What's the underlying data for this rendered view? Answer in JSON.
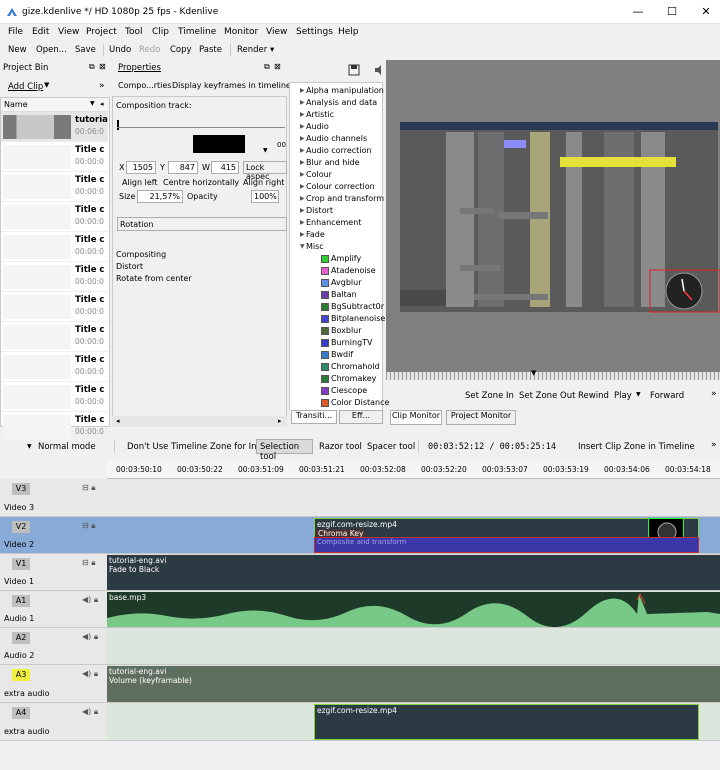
{
  "window": {
    "title": "gize.kdenlive */ HD 1080p 25 fps - Kdenlive",
    "minimize": "—",
    "maximize": "☐",
    "close": "✕"
  },
  "menu": [
    "File",
    "Edit",
    "View",
    "Project",
    "Tool",
    "Clip",
    "Timeline",
    "Monitor",
    "View",
    "Settings",
    "Help"
  ],
  "toolbar": [
    "New",
    "Open...",
    "Save",
    "Undo",
    "Redo",
    "Copy",
    "Paste",
    "Render ▾"
  ],
  "project_bin": {
    "title": "Project Bin",
    "add_clip": "Add Clip",
    "name_header": "Name",
    "clips": [
      {
        "name": "tutoria",
        "dur": "00:06:0"
      },
      {
        "name": "Title c",
        "dur": "00:00:0"
      },
      {
        "name": "Title c",
        "dur": "00:00:0"
      },
      {
        "name": "Title c",
        "dur": "00:00:0"
      },
      {
        "name": "Title c",
        "dur": "00:00:0"
      },
      {
        "name": "Title c",
        "dur": "00:00:0"
      },
      {
        "name": "Title c",
        "dur": "00:00:0"
      },
      {
        "name": "Title c",
        "dur": "00:00:0"
      },
      {
        "name": "Title c",
        "dur": "00:00:0"
      },
      {
        "name": "Title c",
        "dur": "00:00:0"
      },
      {
        "name": "Title c",
        "dur": "00:00:0"
      }
    ]
  },
  "properties": {
    "title": "Properties",
    "tab_compo": "Compo...rties",
    "tab_keyframes": "Display keyframes in timeline",
    "comp_track": "Composition track:",
    "x_label": "X",
    "x": "1505",
    "y_label": "Y",
    "y": "847",
    "w_label": "W",
    "w": "415",
    "lock": "Lock aspec",
    "align_left": "Align left",
    "centre_h": "Centre horizontally",
    "align_right": "Align right",
    "size_label": "Size",
    "size": "21,57%",
    "opacity_label": "Opacity",
    "opacity": "100%",
    "rotation": "Rotation",
    "list": [
      "Compositing",
      "Distort",
      "Rotate from center"
    ]
  },
  "effects": {
    "categories": [
      "Alpha manipulation",
      "Analysis and data",
      "Artistic",
      "Audio",
      "Audio channels",
      "Audio correction",
      "Blur and hide",
      "Colour",
      "Colour correction",
      "Crop and transform",
      "Distort",
      "Enhancement",
      "Fade",
      "Misc"
    ],
    "misc": [
      {
        "name": "Amplify",
        "color": "#33cc33"
      },
      {
        "name": "Atadenoise",
        "color": "#e85fd0"
      },
      {
        "name": "Avgblur",
        "color": "#5f8fe8"
      },
      {
        "name": "Baltan",
        "color": "#6b3fa8"
      },
      {
        "name": "BgSubtract0r",
        "color": "#2f7a2f"
      },
      {
        "name": "Bitplanenoise",
        "color": "#4444cc"
      },
      {
        "name": "Boxblur",
        "color": "#4a6a3a"
      },
      {
        "name": "BurningTV",
        "color": "#3a3acc"
      },
      {
        "name": "Bwdif",
        "color": "#3a7acc"
      },
      {
        "name": "Chromahold",
        "color": "#2e8a6a"
      },
      {
        "name": "Chromakey",
        "color": "#2e7a3e"
      },
      {
        "name": "Ciescope",
        "color": "#8a3ac8"
      },
      {
        "name": "Color Distance",
        "color": "#d85a2a"
      }
    ],
    "tab_transitions": "Transiti...",
    "tab_effects": "Eff..."
  },
  "monitor": {
    "set_zone_in": "Set Zone In",
    "set_zone_out": "Set Zone Out",
    "rewind": "Rewind",
    "play": "Play",
    "forward": "Forward",
    "tab_clip": "Clip Monitor",
    "tab_project": "Project Monitor"
  },
  "timeline_toolbar": {
    "mode": "Normal mode",
    "no_zone": "Don't Use Timeline Zone for Insert",
    "selection": "Selection tool",
    "razor": "Razor tool",
    "spacer": "Spacer tool",
    "timecode": "00:03:52:12 / 00:05:25:14",
    "insert_zone": "Insert Clip Zone in Timeline"
  },
  "ruler": [
    "00:03:50:10",
    "00:03:50:22",
    "00:03:51:09",
    "00:03:51:21",
    "00:03:52:08",
    "00:03:52:20",
    "00:03:53:07",
    "00:03:53:19",
    "00:03:54:06",
    "00:03:54:18"
  ],
  "tracks": [
    {
      "tag": "V3",
      "name": "Video 3"
    },
    {
      "tag": "V2",
      "name": "Video 2"
    },
    {
      "tag": "V1",
      "name": "Video 1"
    },
    {
      "tag": "A1",
      "name": "Audio 1"
    },
    {
      "tag": "A2",
      "name": "Audio 2"
    },
    {
      "tag": "A3",
      "name": "extra audio"
    },
    {
      "tag": "A4",
      "name": "extra audio"
    }
  ],
  "clips": {
    "v2_clip": "ezgif.com-resize.mp4",
    "v2_effect": "Chroma Key",
    "v2_comp": "Composite and transform",
    "v1_clip": "tutorial-eng.avi",
    "v1_effect": "Fade to Black",
    "a1_clip": "base.mp3",
    "a3_clip": "tutorial-eng.avi",
    "a3_effect": "Volume (keyframable)",
    "a4_clip": "ezgif.com-resize.mp4"
  }
}
